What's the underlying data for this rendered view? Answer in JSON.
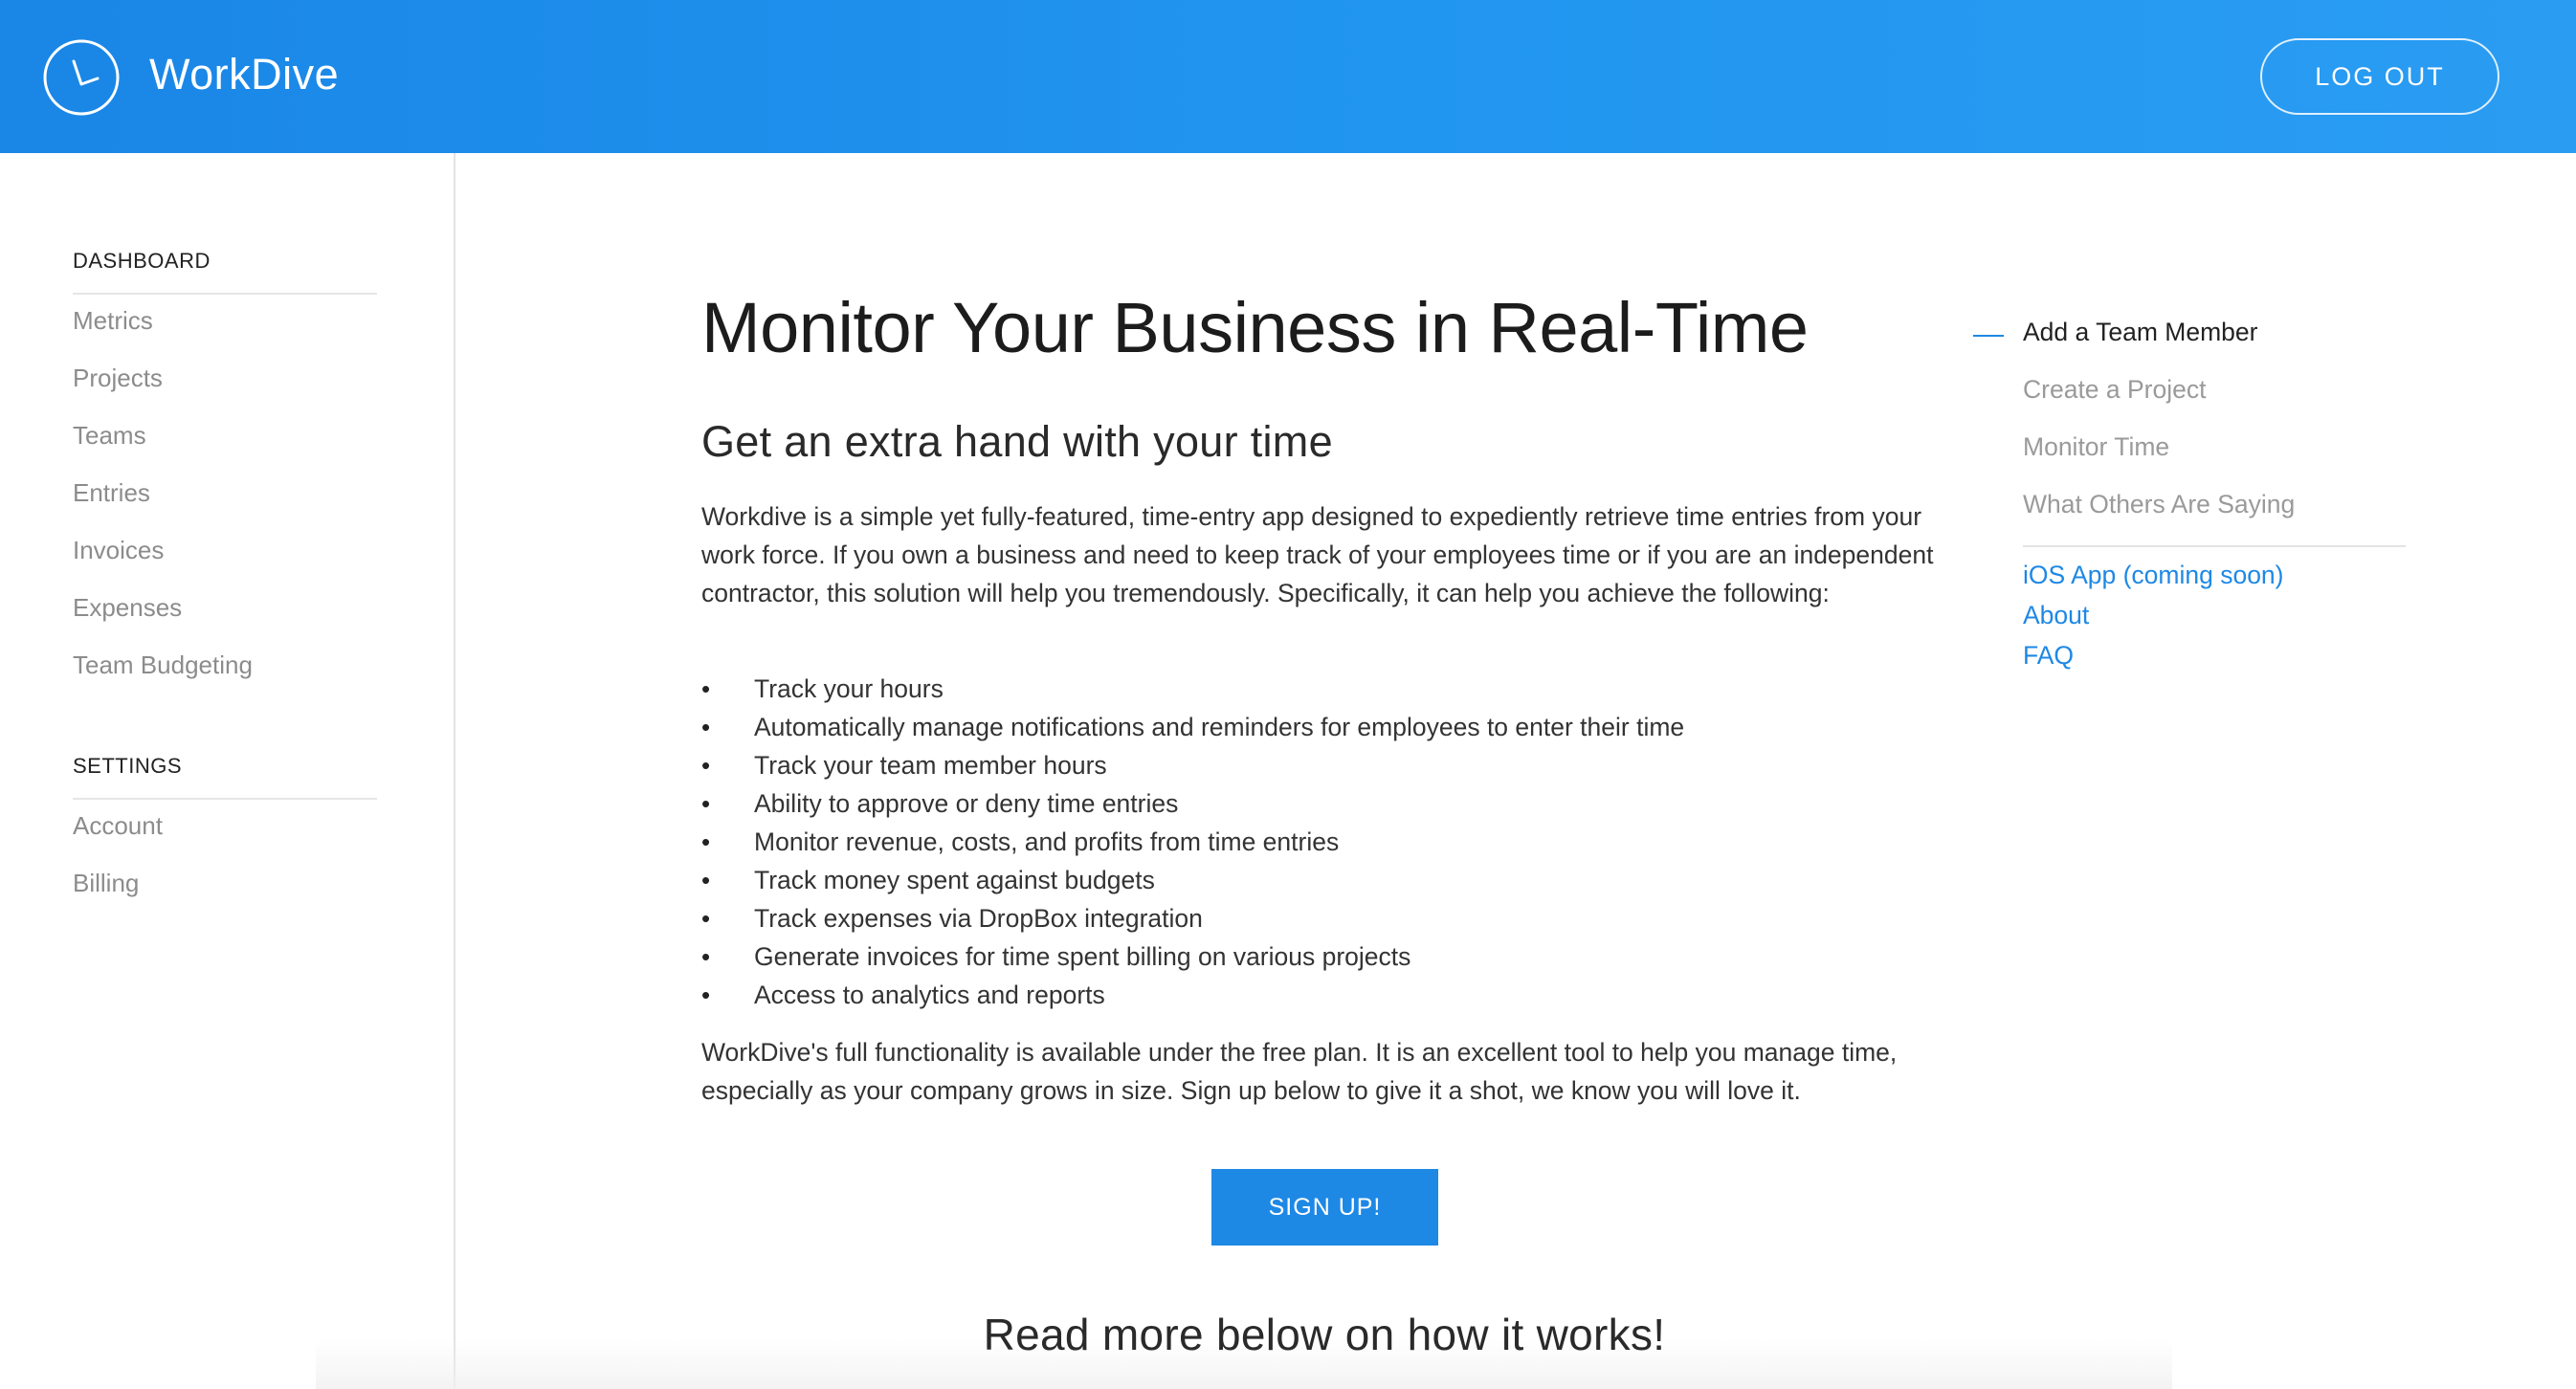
{
  "header": {
    "brand": "WorkDive",
    "logo_icon": "clock-icon",
    "logout_label": "LOG OUT",
    "gradient_start": "#1a86e6",
    "gradient_end": "#2a9cf2"
  },
  "sidebar": {
    "dashboard_title": "DASHBOARD",
    "dashboard_items": [
      "Metrics",
      "Projects",
      "Teams",
      "Entries",
      "Invoices",
      "Expenses",
      "Team Budgeting"
    ],
    "settings_title": "SETTINGS",
    "settings_items": [
      "Account",
      "Billing"
    ]
  },
  "main": {
    "title": "Monitor Your Business in Real-Time",
    "subtitle": "Get an extra hand with your time",
    "intro": "Workdive is a simple yet fully-featured, time-entry app designed to expediently retrieve time entries from your work force. If you own a business and need to keep track of your employees time or if you are an independent contractor, this solution will help you tremendously. Specifically, it can help you achieve the following:",
    "features": [
      "Track your hours",
      "Automatically manage notifications and reminders for employees to enter their time",
      "Track your team member hours",
      "Ability to approve or deny time entries",
      "Monitor revenue, costs, and profits from time entries",
      "Track money spent against budgets",
      "Track expenses via DropBox integration",
      "Generate invoices for time spent billing on various projects",
      "Access to analytics and reports"
    ],
    "bullet": "•",
    "outro": "WorkDive's full functionality is available under the free plan. It is an excellent tool to help you manage time, especially as your company grows in size. Sign up below to give it a shot, we know you will love it.",
    "signup_label": "SIGN UP!",
    "signup_color": "#1e88e5",
    "readmore": "Read more below on how it works!"
  },
  "toc": {
    "items": [
      "Add a Team Member",
      "Create a Project",
      "Monitor Time",
      "What Others Are Saying"
    ],
    "links": [
      "iOS App (coming soon)",
      "About",
      "FAQ"
    ],
    "accent": "#1e88e5"
  }
}
